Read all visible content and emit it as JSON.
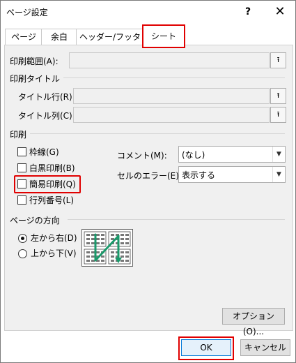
{
  "window": {
    "title": "ページ設定",
    "help_label": "?",
    "close_label": "✕"
  },
  "tabs": [
    {
      "label": "ページ",
      "active": false
    },
    {
      "label": "余白",
      "active": false
    },
    {
      "label": "ヘッダー/フッター",
      "active": false
    },
    {
      "label": "シート",
      "active": true
    }
  ],
  "print_area": {
    "label": "印刷範囲(A):",
    "value": ""
  },
  "print_titles": {
    "section_label": "印刷タイトル",
    "row_label": "タイトル行(R):",
    "row_value": "",
    "col_label": "タイトル列(C):",
    "col_value": ""
  },
  "print": {
    "section_label": "印刷",
    "checkboxes": [
      {
        "label": "枠線(G)",
        "checked": false
      },
      {
        "label": "白黒印刷(B)",
        "checked": false
      },
      {
        "label": "簡易印刷(Q)",
        "checked": false
      },
      {
        "label": "行列番号(L)",
        "checked": false
      }
    ],
    "comment_label": "コメント(M):",
    "comment_value": "(なし)",
    "error_label": "セルのエラー(E):",
    "error_value": "表示する"
  },
  "page_order": {
    "section_label": "ページの方向",
    "options": [
      {
        "label": "左から右(D)",
        "selected": true
      },
      {
        "label": "上から下(V)",
        "selected": false
      }
    ]
  },
  "buttons": {
    "options": "オプション(O)...",
    "ok": "OK",
    "cancel": "キャンセル"
  },
  "colors": {
    "highlight": "#e00000",
    "accent": "#0078d7",
    "arrow": "#1a9a6b"
  },
  "icons": {
    "pick": "⭱",
    "dropdown": "chevron-down-icon"
  }
}
